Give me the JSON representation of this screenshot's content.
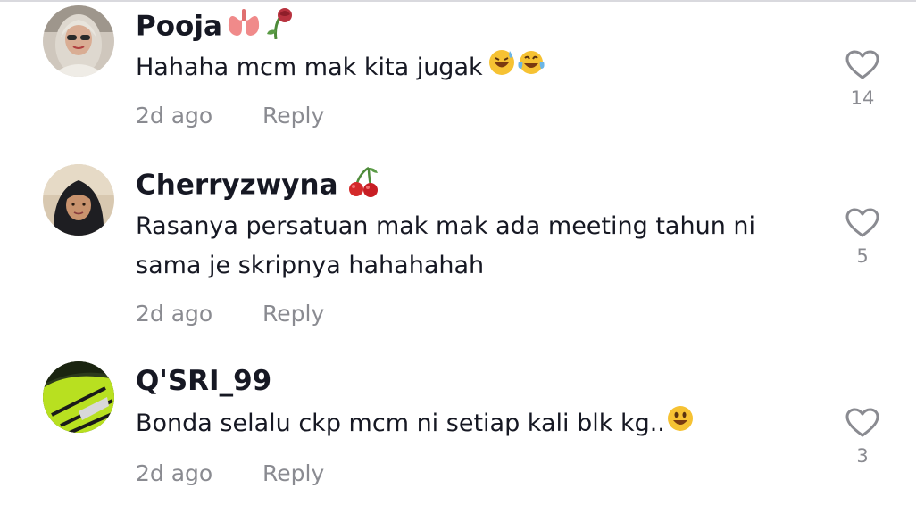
{
  "colors": {
    "text": "#161823",
    "secondary": "#8a8b91",
    "heart_outline": "#8a8b91"
  },
  "comments": [
    {
      "username": "Pooja",
      "username_emojis": [
        "lungs-emoji",
        "wilted-rose-emoji"
      ],
      "text": "Hahaha mcm mak kita jugak",
      "text_emojis": [
        "grinning-sweat-emoji",
        "tears-of-joy-emoji"
      ],
      "time": "2d ago",
      "reply_label": "Reply",
      "likes": "14"
    },
    {
      "username": "Cherryzwyna",
      "username_emojis": [
        "cherries-emoji"
      ],
      "text": "Rasanya persatuan mak mak ada meeting tahun ni sama je skripnya hahahahah",
      "text_emojis": [],
      "time": "2d ago",
      "reply_label": "Reply",
      "likes": "5"
    },
    {
      "username": "Q'SRI_99",
      "username_emojis": [],
      "text": "Bonda selalu ckp mcm ni setiap kali blk kg..",
      "text_emojis": [
        "smiley-emoji"
      ],
      "time": "2d ago",
      "reply_label": "Reply",
      "likes": "3"
    }
  ]
}
